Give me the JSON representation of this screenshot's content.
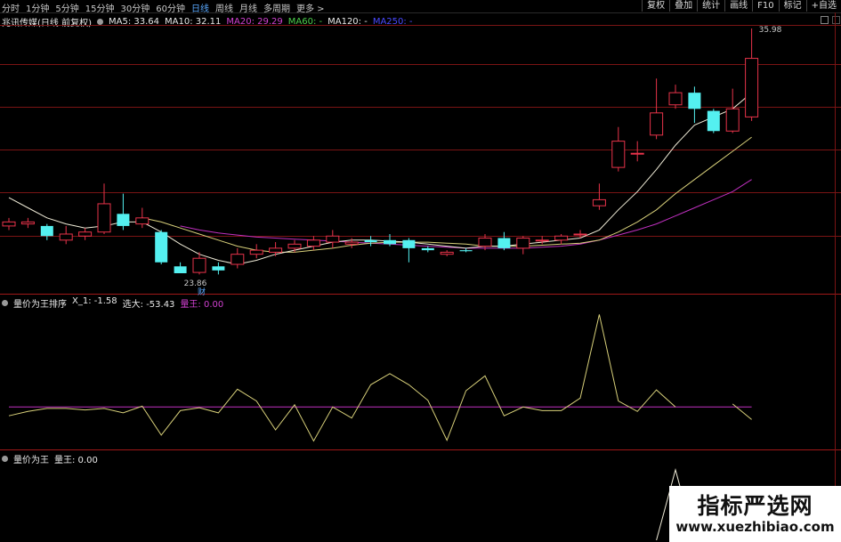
{
  "toolbar": {
    "periods": [
      "分时",
      "1分钟",
      "5分钟",
      "15分钟",
      "30分钟",
      "60分钟",
      "日线",
      "周线",
      "月线",
      "多周期",
      "更多 >"
    ],
    "active_period": "日线",
    "right_buttons": [
      "复权",
      "叠加",
      "统计",
      "画线",
      "F10",
      "标记",
      "+自选"
    ]
  },
  "main_legend": {
    "title": "兆讯传媒(日线 前复权)",
    "items": [
      {
        "label": "MA5: 33.64",
        "color": "#e8e8e8"
      },
      {
        "label": "MA10: 32.11",
        "color": "#e8e8e8"
      },
      {
        "label": "MA20: 29.29",
        "color": "#d040d0"
      },
      {
        "label": "MA60: -",
        "color": "#4cd04c"
      },
      {
        "label": "MA120: -",
        "color": "#e8e8e8"
      },
      {
        "label": "MA250: -",
        "color": "#4a4aff"
      }
    ]
  },
  "annotations": {
    "high_label": "35.98",
    "low_label": "23.86",
    "fin_marker": "财"
  },
  "sub1_legend": {
    "items": [
      {
        "label": "量价为王排序",
        "color": "#e8e8e8"
      },
      {
        "label": "X_1: -1.58",
        "color": "#e8e8e8"
      },
      {
        "label": "选大: -53.43",
        "color": "#e8e8e8"
      },
      {
        "label": "量王: 0.00",
        "color": "#d040d0"
      }
    ]
  },
  "sub2_legend": {
    "items": [
      {
        "label": "量价为王",
        "color": "#e8e8e8"
      },
      {
        "label": "量王: 0.00",
        "color": "#e8e8e8"
      }
    ]
  },
  "watermark": {
    "main": "指标严选网",
    "url": "www.xuezhibiao.com"
  },
  "colors": {
    "up": "#e8334a",
    "down": "#54f0f0",
    "ma_white": "#f0ecd8",
    "ma_yellow": "#d8d07a",
    "ma_magenta": "#c030c0",
    "grid": "#7a1414"
  },
  "chart_data": {
    "type": "candlestick",
    "price_range": [
      23.86,
      35.98
    ],
    "candles": [
      {
        "o": 26.2,
        "c": 26.4,
        "h": 26.6,
        "l": 26.0
      },
      {
        "o": 26.3,
        "c": 26.4,
        "h": 26.6,
        "l": 26.1
      },
      {
        "o": 26.2,
        "c": 25.7,
        "h": 26.3,
        "l": 25.5
      },
      {
        "o": 25.5,
        "c": 25.8,
        "h": 26.2,
        "l": 25.3
      },
      {
        "o": 25.7,
        "c": 25.9,
        "h": 26.1,
        "l": 25.5
      },
      {
        "o": 25.9,
        "c": 27.3,
        "h": 28.3,
        "l": 25.8
      },
      {
        "o": 26.8,
        "c": 26.2,
        "h": 27.8,
        "l": 26.0
      },
      {
        "o": 26.3,
        "c": 26.6,
        "h": 27.1,
        "l": 26.1
      },
      {
        "o": 25.9,
        "c": 24.4,
        "h": 26.0,
        "l": 24.3
      },
      {
        "o": 24.2,
        "c": 23.86,
        "h": 24.4,
        "l": 23.86
      },
      {
        "o": 23.9,
        "c": 24.6,
        "h": 24.9,
        "l": 23.8
      },
      {
        "o": 24.2,
        "c": 24.0,
        "h": 24.4,
        "l": 23.8
      },
      {
        "o": 24.3,
        "c": 24.8,
        "h": 25.1,
        "l": 24.1
      },
      {
        "o": 24.8,
        "c": 25.0,
        "h": 25.3,
        "l": 24.6
      },
      {
        "o": 24.9,
        "c": 25.1,
        "h": 25.4,
        "l": 24.7
      },
      {
        "o": 25.1,
        "c": 25.3,
        "h": 25.5,
        "l": 24.9
      },
      {
        "o": 25.2,
        "c": 25.5,
        "h": 25.7,
        "l": 25.0
      },
      {
        "o": 25.4,
        "c": 25.7,
        "h": 26.0,
        "l": 25.1
      },
      {
        "o": 25.3,
        "c": 25.4,
        "h": 25.6,
        "l": 25.1
      },
      {
        "o": 25.5,
        "c": 25.4,
        "h": 25.7,
        "l": 25.2
      },
      {
        "o": 25.5,
        "c": 25.3,
        "h": 25.8,
        "l": 25.2
      },
      {
        "o": 25.5,
        "c": 25.1,
        "h": 25.6,
        "l": 24.4
      },
      {
        "o": 25.1,
        "c": 25.0,
        "h": 25.2,
        "l": 24.9
      },
      {
        "o": 24.8,
        "c": 24.9,
        "h": 25.0,
        "l": 24.7
      },
      {
        "o": 25.0,
        "c": 24.95,
        "h": 25.1,
        "l": 24.9
      },
      {
        "o": 25.2,
        "c": 25.6,
        "h": 25.8,
        "l": 25.0
      },
      {
        "o": 25.6,
        "c": 25.1,
        "h": 25.9,
        "l": 25.0
      },
      {
        "o": 25.1,
        "c": 25.6,
        "h": 25.7,
        "l": 24.8
      },
      {
        "o": 25.5,
        "c": 25.5,
        "h": 25.7,
        "l": 25.3
      },
      {
        "o": 25.5,
        "c": 25.7,
        "h": 25.8,
        "l": 25.3
      },
      {
        "o": 25.8,
        "c": 25.8,
        "h": 26.0,
        "l": 25.6
      },
      {
        "o": 27.2,
        "c": 27.5,
        "h": 28.3,
        "l": 27.0
      },
      {
        "o": 29.1,
        "c": 30.4,
        "h": 31.1,
        "l": 28.9
      },
      {
        "o": 29.8,
        "c": 29.8,
        "h": 30.4,
        "l": 29.4
      },
      {
        "o": 30.7,
        "c": 31.8,
        "h": 33.5,
        "l": 30.5
      },
      {
        "o": 32.2,
        "c": 32.8,
        "h": 33.2,
        "l": 32.0
      },
      {
        "o": 32.8,
        "c": 32.0,
        "h": 33.1,
        "l": 31.3
      },
      {
        "o": 31.9,
        "c": 30.9,
        "h": 32.0,
        "l": 30.8
      },
      {
        "o": 30.9,
        "c": 32.0,
        "h": 33.0,
        "l": 30.8
      },
      {
        "o": 31.6,
        "c": 34.5,
        "h": 35.98,
        "l": 31.4
      }
    ],
    "ma5": [
      27.6,
      27.1,
      26.6,
      26.3,
      26.1,
      26.2,
      26.4,
      26.4,
      25.9,
      25.3,
      24.8,
      24.5,
      24.3,
      24.5,
      24.8,
      25.0,
      25.2,
      25.4,
      25.5,
      25.5,
      25.45,
      25.4,
      25.3,
      25.2,
      25.1,
      25.2,
      25.2,
      25.3,
      25.4,
      25.5,
      25.6,
      26.0,
      27.0,
      27.9,
      29.0,
      30.2,
      31.2,
      31.6,
      32.0,
      32.8
    ],
    "ma10": [
      null,
      null,
      null,
      null,
      null,
      null,
      null,
      26.6,
      26.4,
      26.1,
      25.8,
      25.5,
      25.2,
      25.0,
      24.9,
      24.9,
      25.0,
      25.1,
      25.25,
      25.35,
      25.4,
      25.4,
      25.4,
      25.35,
      25.3,
      25.2,
      25.2,
      25.2,
      25.25,
      25.3,
      25.35,
      25.5,
      25.9,
      26.4,
      27.0,
      27.8,
      28.5,
      29.2,
      29.9,
      30.6
    ],
    "ma20": [
      null,
      null,
      null,
      null,
      null,
      null,
      null,
      null,
      null,
      26.2,
      26.0,
      25.85,
      25.75,
      25.65,
      25.6,
      25.55,
      25.5,
      25.45,
      25.4,
      25.35,
      25.3,
      25.25,
      25.2,
      25.15,
      25.1,
      25.1,
      25.1,
      25.1,
      25.15,
      25.2,
      25.3,
      25.5,
      25.75,
      26.0,
      26.3,
      26.7,
      27.1,
      27.5,
      27.9,
      28.5
    ],
    "sub1_line": [
      -1.2,
      -0.6,
      -0.2,
      -0.2,
      -0.4,
      -0.2,
      -0.8,
      0.1,
      -3.8,
      -0.5,
      -0.1,
      -0.8,
      2.4,
      0.8,
      -3.1,
      0.3,
      -4.6,
      0.0,
      -1.5,
      3.0,
      4.5,
      3.0,
      0.9,
      -4.5,
      2.2,
      4.2,
      -1.2,
      0.0,
      -0.5,
      -0.5,
      1.2,
      12.5,
      0.8,
      -0.6,
      2.3,
      0.0,
      null,
      null,
      0.4,
      -1.7
    ],
    "sub1_flat": 0,
    "sub1_range": [
      -5.5,
      13.5
    ],
    "sub2_line": [
      {
        "i": 34,
        "v": 0
      },
      {
        "i": 35,
        "v": 1
      },
      {
        "i": 36,
        "v": 0
      }
    ],
    "sub2_range": [
      0,
      1.1
    ]
  }
}
